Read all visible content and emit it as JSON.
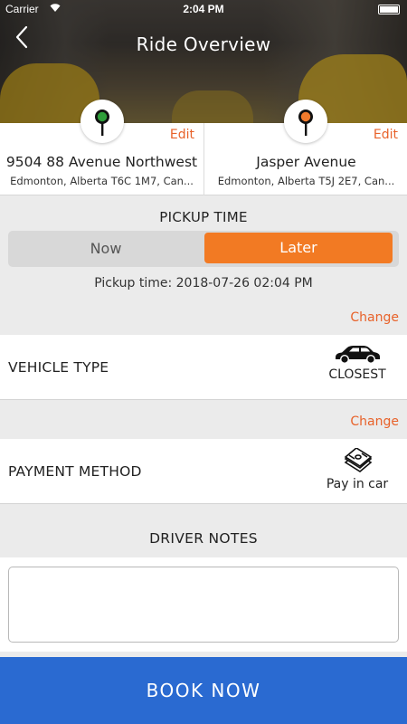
{
  "status_bar": {
    "carrier": "Carrier",
    "time": "2:04 PM"
  },
  "header": {
    "title": "Ride Overview"
  },
  "pickup_location": {
    "edit_label": "Edit",
    "street": "9504 88 Avenue Northwest",
    "city": "Edmonton, Alberta T6C 1M7, Can...",
    "pin_color": "#2e9e3a"
  },
  "dropoff_location": {
    "edit_label": "Edit",
    "street": "Jasper Avenue",
    "city": "Edmonton, Alberta T5J 2E7, Can...",
    "pin_color": "#f07a2c"
  },
  "pickup": {
    "label": "PICKUP TIME",
    "now_label": "Now",
    "later_label": "Later",
    "selected": "Later",
    "time_text": "Pickup time: 2018-07-26 02:04 PM"
  },
  "vehicle": {
    "change_label": "Change",
    "label": "VEHICLE TYPE",
    "value": "CLOSEST",
    "icon": "car-icon"
  },
  "payment": {
    "change_label": "Change",
    "label": "PAYMENT METHOD",
    "value": "Pay in car",
    "icon": "cash-icon"
  },
  "notes": {
    "label": "DRIVER NOTES",
    "value": ""
  },
  "book_button": {
    "label": "BOOK NOW"
  },
  "colors": {
    "accent": "#f27a23",
    "book": "#2a6ad1",
    "link": "#e8622a"
  }
}
